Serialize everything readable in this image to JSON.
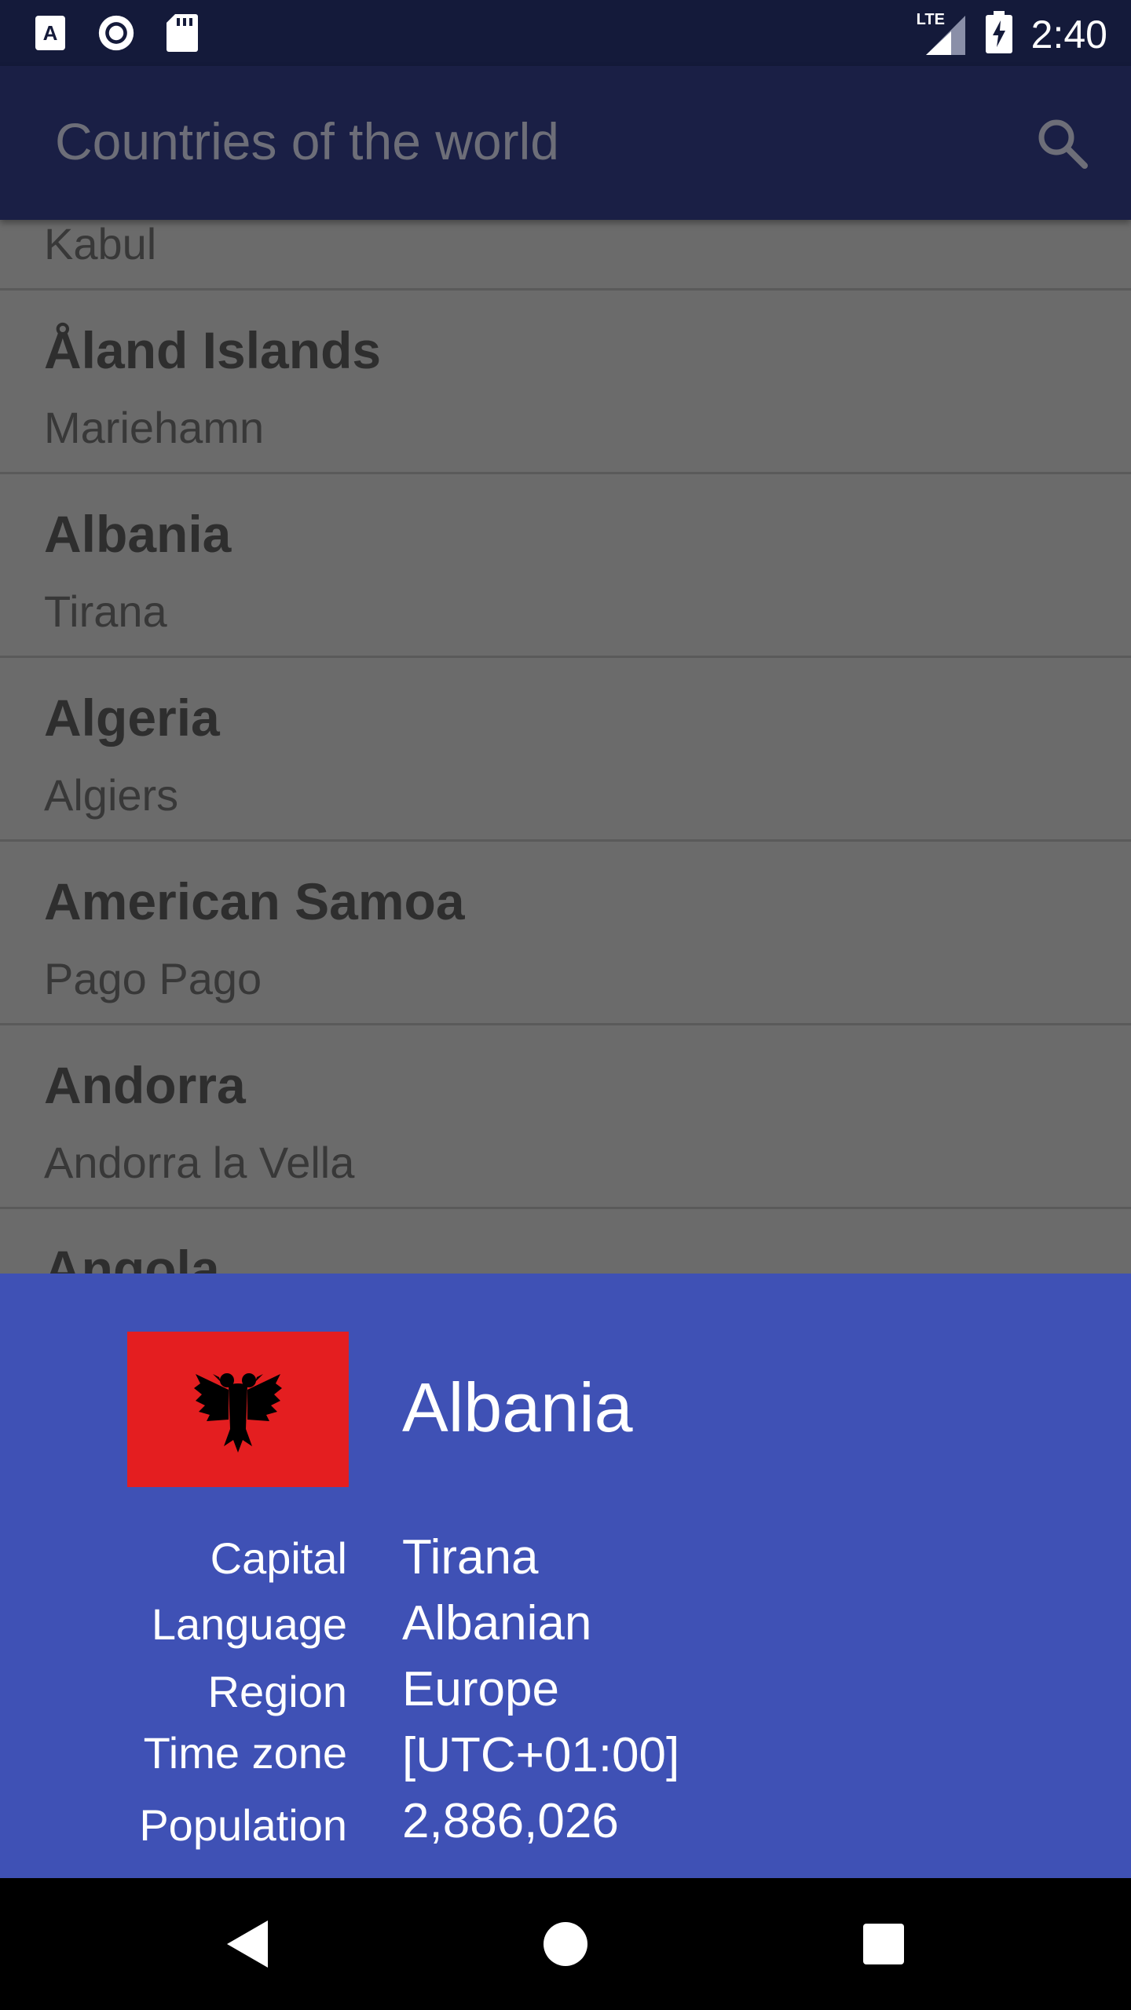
{
  "status_bar": {
    "time": "2:40",
    "network": "LTE",
    "left_icons": [
      "accessibility-a-icon",
      "record-icon",
      "sd-card-icon"
    ],
    "right_icons": [
      "lte-signal-icon",
      "battery-charging-icon"
    ]
  },
  "app_bar": {
    "title": "Countries of the world",
    "search_icon": "search-icon"
  },
  "list": {
    "items": [
      {
        "name": "",
        "capital": "Kabul"
      },
      {
        "name": "Åland Islands",
        "capital": "Mariehamn"
      },
      {
        "name": "Albania",
        "capital": "Tirana"
      },
      {
        "name": "Algeria",
        "capital": "Algiers"
      },
      {
        "name": "American Samoa",
        "capital": "Pago Pago"
      },
      {
        "name": "Andorra",
        "capital": "Andorra la Vella"
      },
      {
        "name": "Angola",
        "capital": ""
      }
    ]
  },
  "detail": {
    "country": "Albania",
    "flag_icon": "albania-flag-icon",
    "flag_colors": {
      "field": "#e41e20",
      "eagle": "#000000"
    },
    "rows": [
      {
        "label": "Capital",
        "value": "Tirana"
      },
      {
        "label": "Language",
        "value": "Albanian"
      },
      {
        "label": "Region",
        "value": "Europe"
      },
      {
        "label": "Time zone",
        "value": "[UTC+01:00]"
      },
      {
        "label": "Population",
        "value": "2,886,026"
      }
    ]
  },
  "nav_bar": {
    "buttons": [
      "back-icon",
      "home-icon",
      "recents-icon"
    ]
  },
  "colors": {
    "status_bar": "#141a3a",
    "app_bar": "#1a1f45",
    "sheet": "#3f51b5",
    "scrim_list": "#6b6b6b"
  }
}
